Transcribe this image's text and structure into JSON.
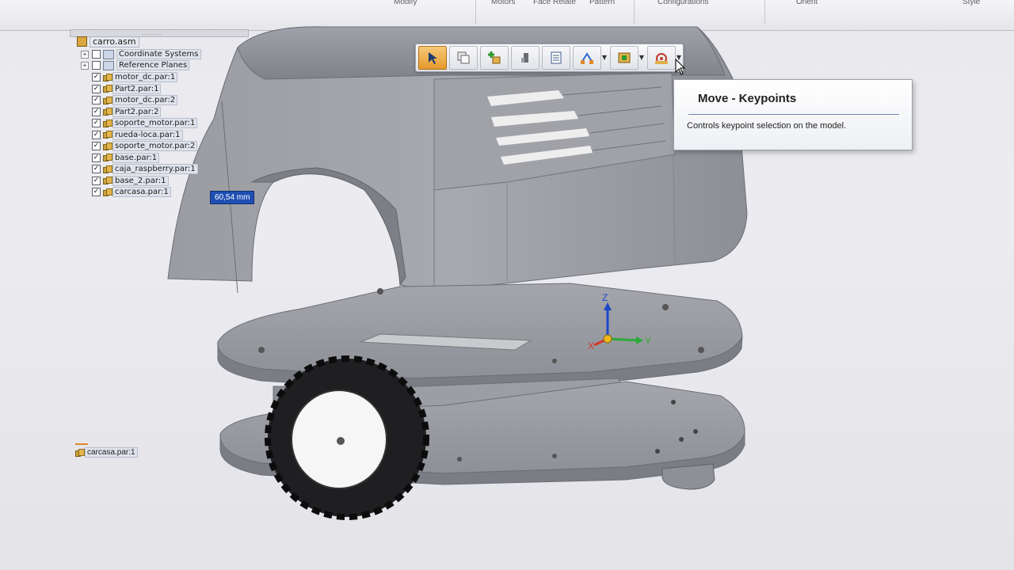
{
  "ribbon": {
    "labels": [
      "Modify",
      "Motors",
      "Face Relate",
      "Pattern",
      "Configurations",
      "Orient",
      "Style"
    ]
  },
  "pathfinder": {
    "root": "carro.asm",
    "folders": [
      "Coordinate Systems",
      "Reference Planes"
    ],
    "parts": [
      "motor_dc.par:1",
      "Part2.par:1",
      "motor_dc.par:2",
      "Part2.par:2",
      "soporte_motor.par:1",
      "rueda-loca.par:1",
      "soporte_motor.par:2",
      "base.par:1",
      "caja_raspberry.par:1",
      "base_2.par:1",
      "carcasa.par:1"
    ],
    "floating_part": "carcasa.par:1"
  },
  "dimension": {
    "value": "60,54 mm"
  },
  "command_bar": {
    "buttons": [
      {
        "name": "select-tool",
        "icon": "arrow-select-icon",
        "active": true
      },
      {
        "name": "copy-part",
        "icon": "copy-icon"
      },
      {
        "name": "add-part",
        "icon": "add-part-icon"
      },
      {
        "name": "move-part",
        "icon": "hand-move-icon"
      },
      {
        "name": "properties",
        "icon": "list-icon"
      },
      {
        "name": "relate",
        "icon": "relate-icon",
        "dropdown": true
      },
      {
        "name": "steering",
        "icon": "steering-wheel-icon",
        "dropdown": true
      },
      {
        "name": "keypoints",
        "icon": "keypoint-icon",
        "dropdown": true
      }
    ]
  },
  "tooltip": {
    "title": "Move - Keypoints",
    "body": "Controls keypoint selection on the model."
  },
  "triad": {
    "x": "X",
    "y": "Y",
    "z": "Z"
  },
  "colors": {
    "accent": "#1f4fb3",
    "active_button": "#e59a2c",
    "model_gray": "#8f9299"
  }
}
